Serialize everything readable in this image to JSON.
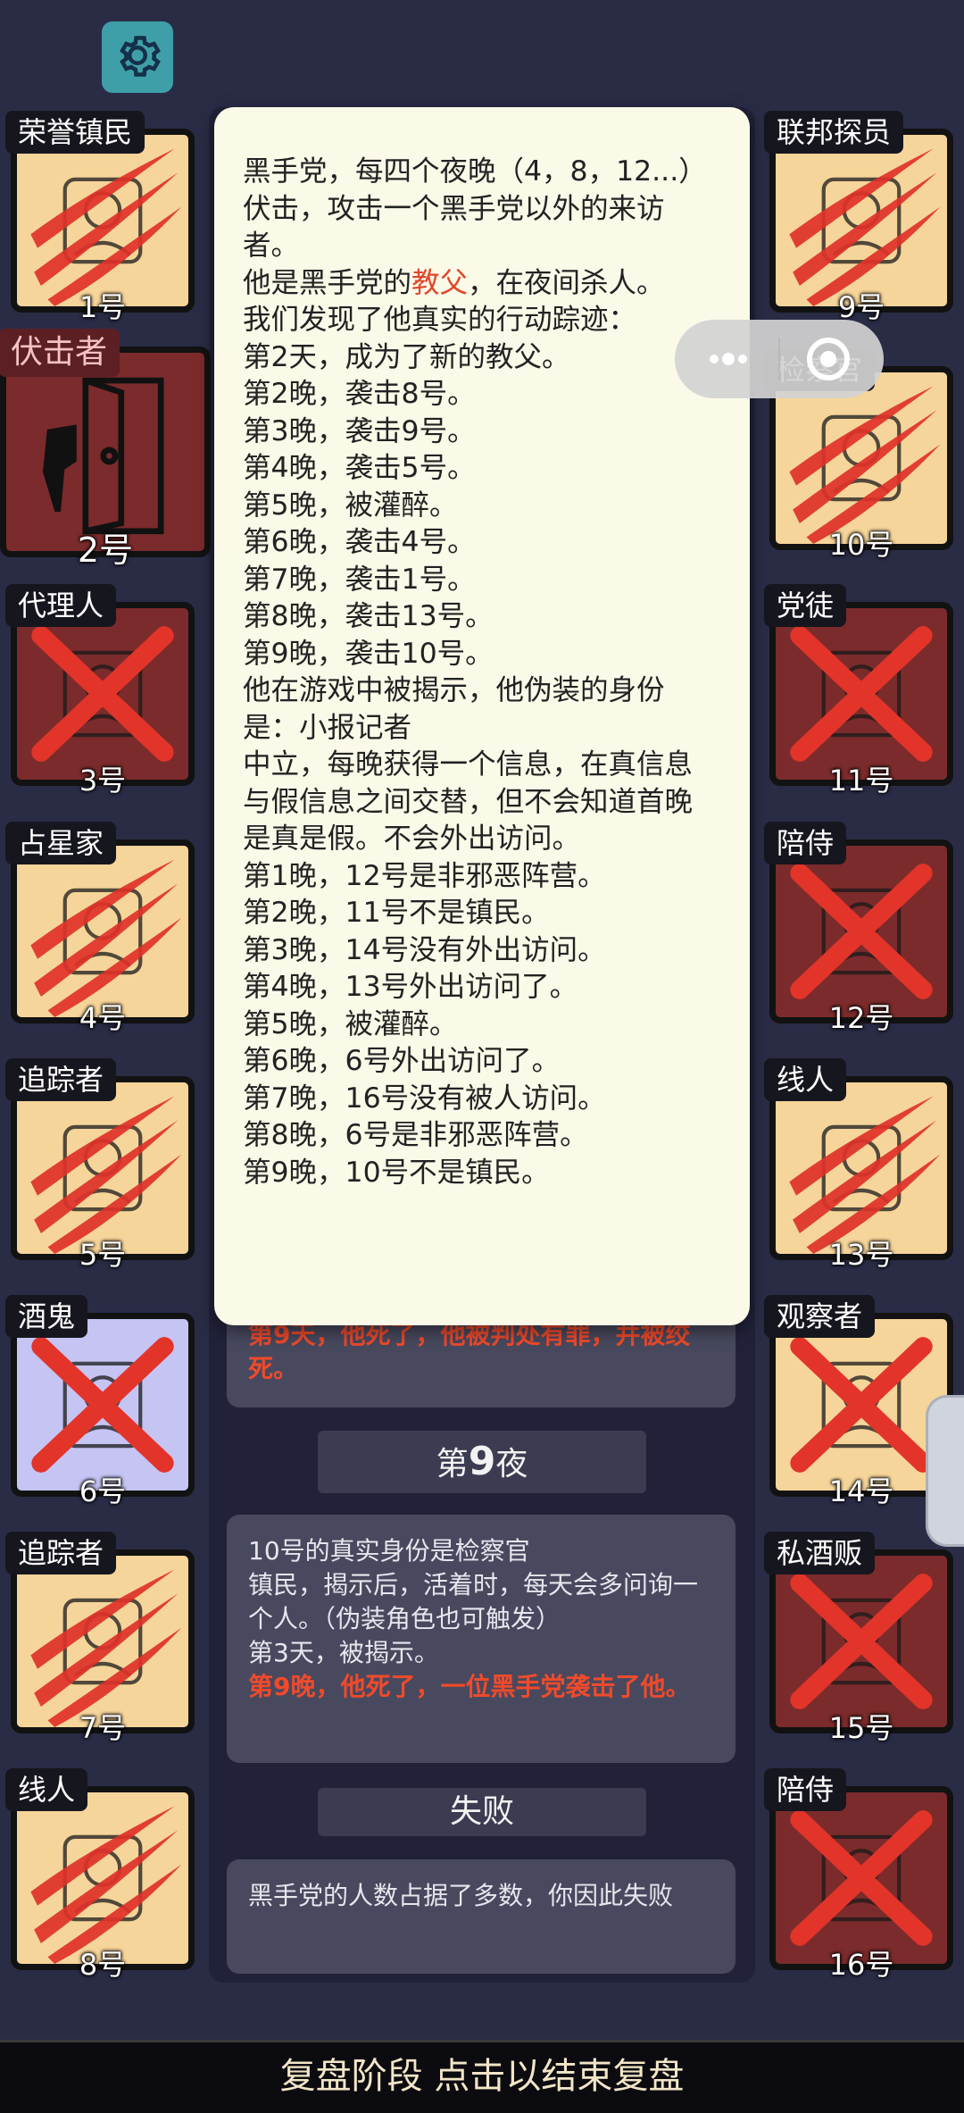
{
  "settings": {
    "icon": "gear-icon"
  },
  "players": [
    {
      "id": "p1",
      "role": "荣誉镇民",
      "num": "1号",
      "team": "town",
      "status": "scratch"
    },
    {
      "id": "p2",
      "role": "伏击者",
      "num": "2号",
      "team": "evil",
      "status": "highlight"
    },
    {
      "id": "p3",
      "role": "代理人",
      "num": "3号",
      "team": "evil",
      "status": "cross"
    },
    {
      "id": "p4",
      "role": "占星家",
      "num": "4号",
      "team": "town",
      "status": "scratch"
    },
    {
      "id": "p5",
      "role": "追踪者",
      "num": "5号",
      "team": "town",
      "status": "scratch"
    },
    {
      "id": "p6",
      "role": "酒鬼",
      "num": "6号",
      "team": "neutral",
      "status": "cross"
    },
    {
      "id": "p7",
      "role": "追踪者",
      "num": "7号",
      "team": "town",
      "status": "scratch"
    },
    {
      "id": "p8",
      "role": "线人",
      "num": "8号",
      "team": "town",
      "status": "scratch"
    },
    {
      "id": "p9",
      "role": "联邦探员",
      "num": "9号",
      "team": "town",
      "status": "scratch"
    },
    {
      "id": "p10",
      "role": "检察官",
      "num": "10号",
      "team": "town",
      "status": "scratch"
    },
    {
      "id": "p11",
      "role": "党徒",
      "num": "11号",
      "team": "evil",
      "status": "cross"
    },
    {
      "id": "p12",
      "role": "陪侍",
      "num": "12号",
      "team": "evil",
      "status": "cross"
    },
    {
      "id": "p13",
      "role": "线人",
      "num": "13号",
      "team": "town",
      "status": "scratch"
    },
    {
      "id": "p14",
      "role": "观察者",
      "num": "14号",
      "team": "town",
      "status": "cross"
    },
    {
      "id": "p15",
      "role": "私酒贩",
      "num": "15号",
      "team": "evil",
      "status": "cross"
    },
    {
      "id": "p16",
      "role": "陪侍",
      "num": "16号",
      "team": "evil",
      "status": "cross"
    }
  ],
  "popup": {
    "intro": "黑手党，每四个夜晚（4，8，12...）伏击，攻击一个黑手党以外的来访者。",
    "godfather_pre": "他是黑手党的",
    "godfather_role": "教父",
    "godfather_post": "，在夜间杀人。",
    "trace_intro": "我们发现了他真实的行动踪迹：",
    "traces": [
      "第2天，成为了新的教父。",
      "第2晚，袭击8号。",
      "第3晚，袭击9号。",
      "第4晚，袭击5号。",
      "第5晚，被灌醉。",
      "第6晚，袭击4号。",
      "第7晚，袭击1号。",
      "第8晚，袭击13号。",
      "第9晚，袭击10号。"
    ],
    "disguise": "他在游戏中被揭示，他伪装的身份是：小报记者",
    "disguise_desc": "中立，每晚获得一个信息，在真信息与假信息之间交替，但不会知道首晚是真是假。不会外出访问。",
    "infos": [
      "第1晚，12号是非邪恶阵营。",
      "第2晚，11号不是镇民。",
      "第3晚，14号没有外出访问。",
      "第4晚，13号外出访问了。",
      "第5晚，被灌醉。",
      "第6晚，6号外出访问了。",
      "第7晚，16号没有被人访问。",
      "第8晚，6号是非邪恶阵营。",
      "第9晚，10号不是镇民。"
    ]
  },
  "log": {
    "partial_red": "第9天，他死了，他被判处有罪，并被绞死。",
    "night_header_pre": "第",
    "night_header_num": "9",
    "night_header_post": "夜",
    "reveal_lines": [
      "10号的真实身份是检察官",
      "镇民，揭示后，活着时，每天会多问询一个人。（伪装角色也可触发）",
      "第3天，被揭示。"
    ],
    "reveal_red": "第9晚，他死了，一位黑手党袭击了他。",
    "result_header": "失败",
    "result_text": "黑手党的人数占据了多数，你因此失败"
  },
  "capsule": {
    "more_icon": "more-dots-icon",
    "close_icon": "target-close-icon"
  },
  "bottom_bar": {
    "label": "复盘阶段 点击以结束复盘"
  },
  "colors": {
    "bg": "#2a2c46",
    "popup": "#fbf9e8",
    "highlight": "#e0472b",
    "town": "#f6d59a",
    "evil": "#7b2b2b",
    "neutral": "#c5c4f3"
  }
}
